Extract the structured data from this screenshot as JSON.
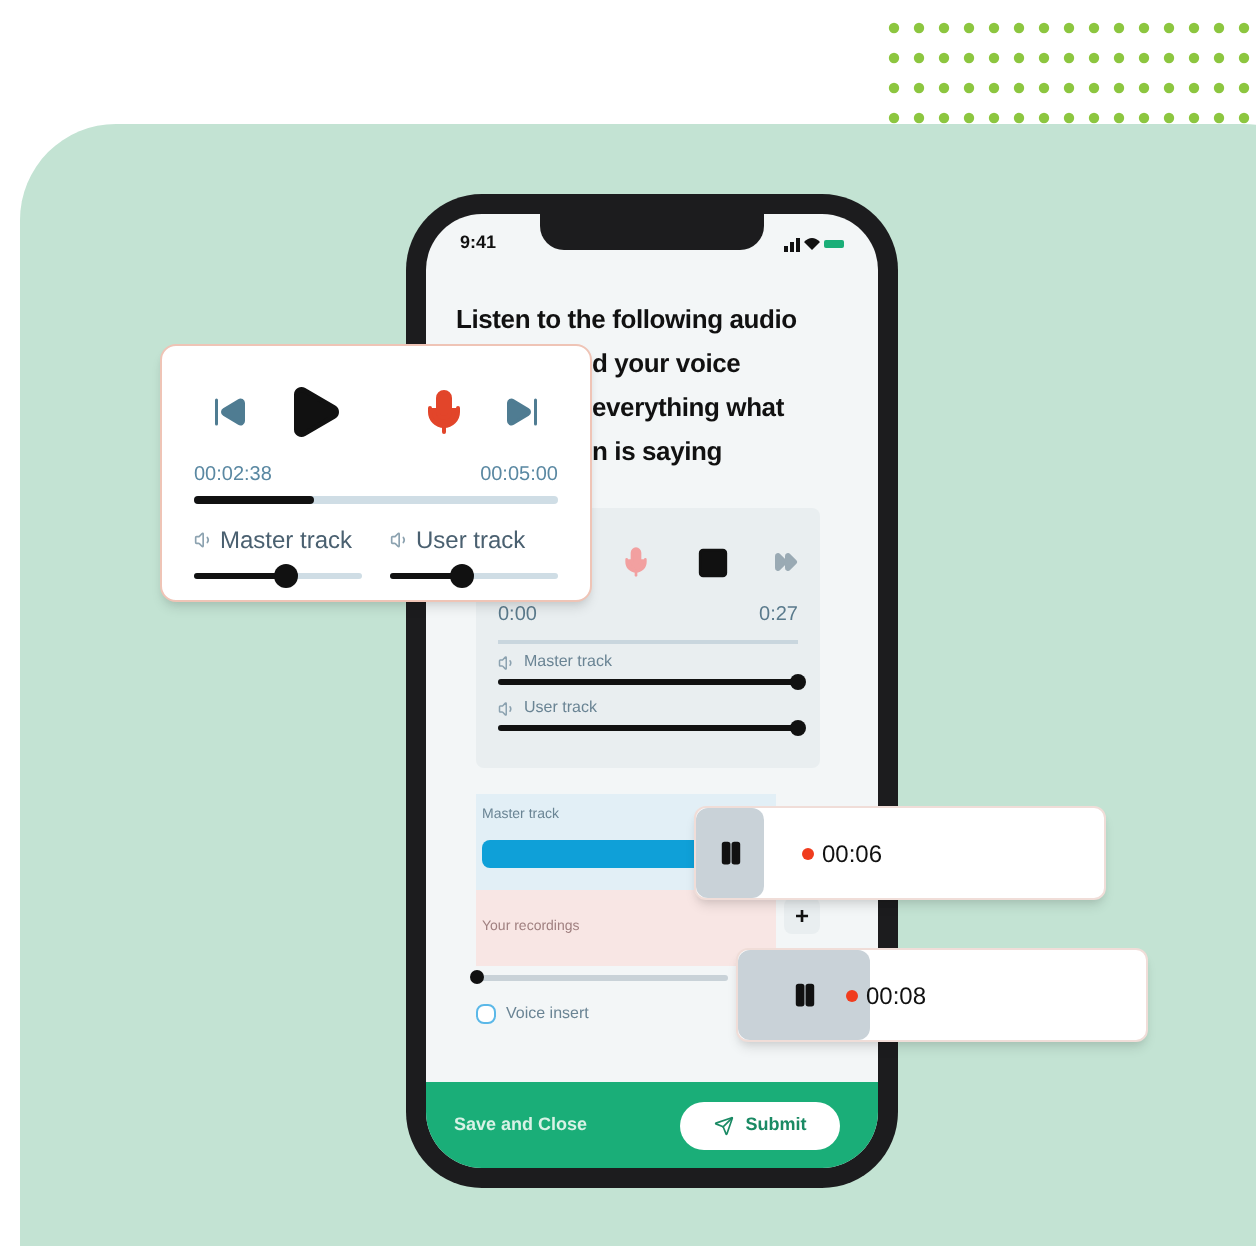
{
  "phone": {
    "status_time": "9:41",
    "question_lines": [
      "Listen to the following audio",
      "d your voice",
      "everything what",
      "n is saying"
    ],
    "player": {
      "start": "0:00",
      "end": "0:27",
      "tracks": [
        {
          "label": "Master track",
          "level": 1
        },
        {
          "label": "User track",
          "level": 1
        }
      ]
    },
    "editor": {
      "master_label": "Master track",
      "recordings_label": "Your recordings",
      "add_button": "+",
      "position": {
        "level": 0
      },
      "checkbox": {
        "label": "Voice insert",
        "checked": false
      }
    },
    "footer": {
      "save": "Save and Close",
      "submit": "Submit"
    }
  },
  "player_card": {
    "elapsed": "00:02:38",
    "total": "00:05:00",
    "progress": {
      "level": 0.33
    },
    "tracks": [
      {
        "label": "Master track",
        "level": 0.55
      },
      {
        "label": "User track",
        "level": 0.43
      }
    ]
  },
  "recordings": [
    {
      "time": "00:06"
    },
    {
      "time": "00:08"
    }
  ]
}
